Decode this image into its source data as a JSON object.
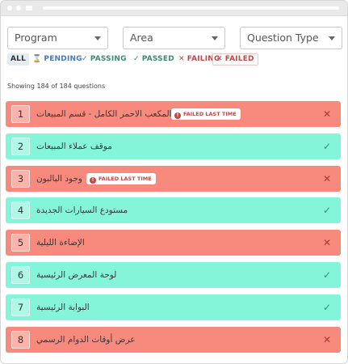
{
  "filters": {
    "program": "Program",
    "area": "Area",
    "question_type": "Question Type"
  },
  "chips": {
    "all": "ALL",
    "pending": "PENDING",
    "passing": "PASSING",
    "passed": "PASSED",
    "failing": "FAILING",
    "failed": "FAILED"
  },
  "summary": "Showing 184 of 184 questions",
  "badge_label": "FAILED LAST TIME",
  "questions": [
    {
      "number": "1",
      "title": "شكل المكعب الاحمر الكامل - قسم المبيعات",
      "status": "failing",
      "failed_last_time": true,
      "status_icon": "x-icon"
    },
    {
      "number": "2",
      "title": "موقف عملاء المبيعات",
      "status": "passing",
      "failed_last_time": false,
      "status_icon": "check-icon"
    },
    {
      "number": "3",
      "title": "وجود البالبون",
      "status": "failing",
      "failed_last_time": true,
      "status_icon": "x-icon"
    },
    {
      "number": "4",
      "title": "مستودع السيارات الجديدة",
      "status": "passing",
      "failed_last_time": false,
      "status_icon": "check-icon"
    },
    {
      "number": "5",
      "title": "الإضاءة الليلية",
      "status": "failing",
      "failed_last_time": false,
      "status_icon": "x-icon"
    },
    {
      "number": "6",
      "title": "لوحة المعرض الرئيسية",
      "status": "passing",
      "failed_last_time": false,
      "status_icon": "check-icon"
    },
    {
      "number": "7",
      "title": "البوابة الرئيسية",
      "status": "passing",
      "failed_last_time": false,
      "status_icon": "check-icon"
    },
    {
      "number": "8",
      "title": "عرض أوقات الدوام الرسمي",
      "status": "failing",
      "failed_last_time": false,
      "status_icon": "x-icon"
    }
  ],
  "colors": {
    "fail_row": "#f8897d",
    "pass_row": "#84f5d8",
    "fail_text": "#c24646",
    "pass_text": "#3a8a78",
    "pending_text": "#4a78b5"
  }
}
